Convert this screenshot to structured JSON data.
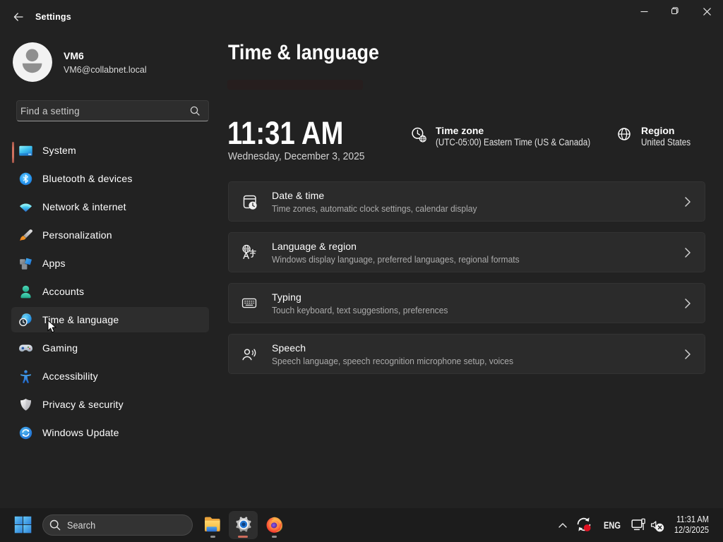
{
  "window": {
    "title": "Settings",
    "caption_buttons": {
      "minimize": "minimize",
      "maximize": "restore",
      "close": "close"
    }
  },
  "sidebar": {
    "profile": {
      "name": "VM6",
      "email": "VM6@collabnet.local"
    },
    "search": {
      "placeholder": "Find a setting"
    },
    "nav": [
      {
        "label": "System"
      },
      {
        "label": "Bluetooth & devices"
      },
      {
        "label": "Network & internet"
      },
      {
        "label": "Personalization"
      },
      {
        "label": "Apps"
      },
      {
        "label": "Accounts"
      },
      {
        "label": "Time & language"
      },
      {
        "label": "Gaming"
      },
      {
        "label": "Accessibility"
      },
      {
        "label": "Privacy & security"
      },
      {
        "label": "Windows Update"
      }
    ],
    "selected": "Time & language"
  },
  "content": {
    "title": "Time & language",
    "clock": {
      "time": "11:31 AM",
      "date": "Wednesday, December 3, 2025"
    },
    "timezone": {
      "title": "Time zone",
      "value": "(UTC-05:00) Eastern Time (US & Canada)"
    },
    "region": {
      "title": "Region",
      "value": "United States"
    },
    "cards": [
      {
        "title": "Date & time",
        "subtitle": "Time zones, automatic clock settings, calendar display"
      },
      {
        "title": "Language & region",
        "subtitle": "Windows display language, preferred languages, regional formats"
      },
      {
        "title": "Typing",
        "subtitle": "Touch keyboard, text suggestions, preferences"
      },
      {
        "title": "Speech",
        "subtitle": "Speech language, speech recognition microphone setup, voices"
      }
    ]
  },
  "taskbar": {
    "search": {
      "label": "Search"
    },
    "tray": {
      "language": "ENG",
      "time": "11:31 AM",
      "date": "12/3/2025"
    }
  },
  "colors": {
    "accent": "#ce6b5b",
    "window_bg": "#222222",
    "taskbar_bg": "#1c1c1c",
    "card_bg": "#2b2b2b"
  }
}
